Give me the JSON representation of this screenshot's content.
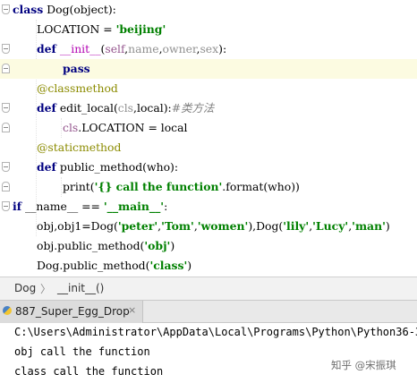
{
  "editor": {
    "lines": [
      {
        "tokens": [
          [
            "kw",
            "class"
          ],
          [
            "plain",
            " Dog(object):"
          ]
        ]
      },
      {
        "tokens": [
          [
            "plain",
            "LOCATION = "
          ],
          [
            "str",
            "'beijing'"
          ]
        ]
      },
      {
        "tokens": [
          [
            "kw",
            "def"
          ],
          [
            "plain",
            " "
          ],
          [
            "magic",
            "__init__"
          ],
          [
            "plain",
            "("
          ],
          [
            "self",
            "self"
          ],
          [
            "plain",
            ","
          ],
          [
            "param",
            "name"
          ],
          [
            "plain",
            ","
          ],
          [
            "param",
            "owner"
          ],
          [
            "plain",
            ","
          ],
          [
            "param",
            "sex"
          ],
          [
            "plain",
            "):"
          ]
        ]
      },
      {
        "tokens": [
          [
            "kw",
            "pass"
          ]
        ]
      },
      {
        "tokens": [
          [
            "dec",
            "@classmethod"
          ]
        ]
      },
      {
        "tokens": [
          [
            "kw",
            "def"
          ],
          [
            "plain",
            " edit_local("
          ],
          [
            "param",
            "cls"
          ],
          [
            "plain",
            ",local):"
          ],
          [
            "cmt",
            "#类方法"
          ]
        ]
      },
      {
        "tokens": [
          [
            "self",
            "cls"
          ],
          [
            "plain",
            ".LOCATION = local"
          ]
        ]
      },
      {
        "tokens": [
          [
            "dec",
            "@staticmethod"
          ]
        ]
      },
      {
        "tokens": [
          [
            "kw",
            "def"
          ],
          [
            "plain",
            " public_method(who):"
          ]
        ]
      },
      {
        "tokens": [
          [
            "plain",
            "print("
          ],
          [
            "str",
            "'{} call the function'"
          ],
          [
            "plain",
            ".format(who))"
          ]
        ]
      },
      {
        "tokens": [
          [
            "kw",
            "if"
          ],
          [
            "plain",
            " __name__ == "
          ],
          [
            "str",
            "'__main__'"
          ],
          [
            "plain",
            ":"
          ]
        ]
      },
      {
        "tokens": [
          [
            "plain",
            "obj,obj1=Dog("
          ],
          [
            "str",
            "'peter'"
          ],
          [
            "plain",
            ","
          ],
          [
            "str",
            "'Tom'"
          ],
          [
            "plain",
            ","
          ],
          [
            "str",
            "'women'"
          ],
          [
            "plain",
            "),Dog("
          ],
          [
            "str",
            "'lily'"
          ],
          [
            "plain",
            ","
          ],
          [
            "str",
            "'Lucy'"
          ],
          [
            "plain",
            ","
          ],
          [
            "str",
            "'man'"
          ],
          [
            "plain",
            ")"
          ]
        ]
      },
      {
        "tokens": [
          [
            "plain",
            "obj.public_method("
          ],
          [
            "str",
            "'obj'"
          ],
          [
            "plain",
            ")"
          ]
        ]
      },
      {
        "tokens": [
          [
            "plain",
            "Dog.public_method("
          ],
          [
            "str",
            "'class'"
          ],
          [
            "plain",
            ")"
          ]
        ]
      }
    ]
  },
  "breadcrumb": {
    "items": [
      "Dog",
      "__init__()"
    ],
    "separator": "〉"
  },
  "run_panel": {
    "tab_label": "887_Super_Egg_Drop",
    "close_glyph": "×",
    "output": [
      "C:\\Users\\Administrator\\AppData\\Local\\Programs\\Python\\Python36-32\\",
      "obj call the function",
      "class call the function"
    ]
  },
  "watermark": "知乎 @宋振琪",
  "colors": {
    "keyword": "#000080",
    "string": "#008000",
    "decorator": "#8b8b00",
    "parameter": "#909090",
    "self": "#94558d",
    "magic": "#b200b2",
    "current_line": "#fcfbe1"
  }
}
